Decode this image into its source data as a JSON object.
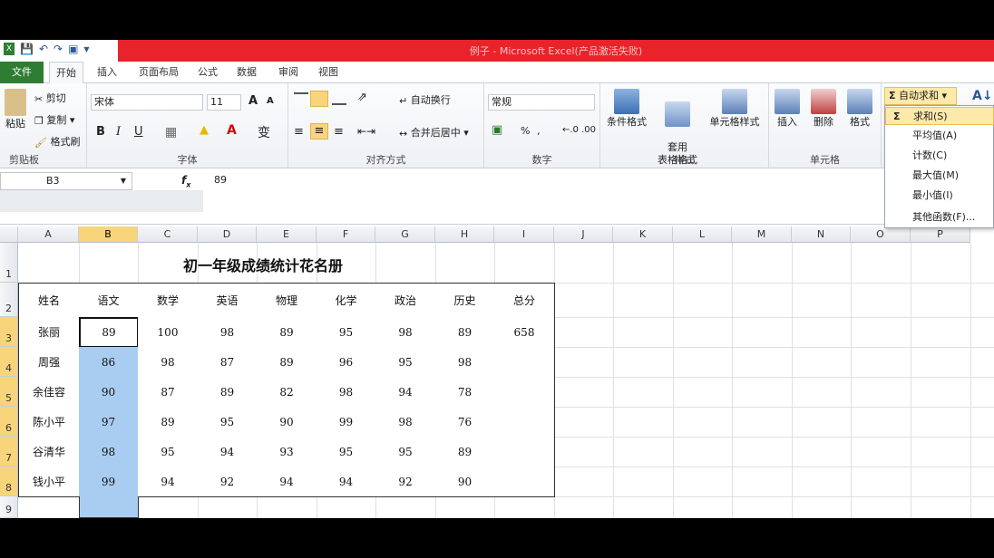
{
  "window": {
    "title": "例子 - Microsoft Excel(产品激活失败)"
  },
  "quick_access": {
    "icons": [
      "save-icon",
      "undo-icon",
      "redo-icon",
      "customize-icon"
    ]
  },
  "tabs": [
    "文件",
    "开始",
    "插入",
    "页面布局",
    "公式",
    "数据",
    "审阅",
    "视图"
  ],
  "ribbon": {
    "clipboard": {
      "label": "剪贴板",
      "paste": "粘贴",
      "cut": "剪切",
      "copy": "复制",
      "format_painter": "格式刷"
    },
    "font": {
      "label": "字体",
      "font_name": "宋体",
      "font_size": "11",
      "grow": "A",
      "shrink": "A",
      "bold": "B",
      "italic": "I",
      "underline": "U",
      "font_color_letter": "A",
      "wen": "变"
    },
    "alignment": {
      "label": "对齐方式",
      "wrap": "自动换行",
      "merge": "合并后居中"
    },
    "number": {
      "label": "数字",
      "format": "常规",
      "percent": "%",
      "comma": ","
    },
    "styles": {
      "label": "样式",
      "conditional": "条件格式",
      "table": "套用\n表格格式",
      "cell_styles": "单元格样式"
    },
    "cells": {
      "label": "单元格",
      "insert": "插入",
      "delete": "删除",
      "format": "格式"
    },
    "editing": {
      "autosum": "自动求和"
    }
  },
  "autosum_menu": {
    "items": [
      "求和(S)",
      "平均值(A)",
      "计数(C)",
      "最大值(M)",
      "最小值(I)",
      "其他函数(F)..."
    ]
  },
  "formula_bar": {
    "name_box": "B3",
    "fx": "f",
    "value": "89"
  },
  "columns": [
    "A",
    "B",
    "C",
    "D",
    "E",
    "F",
    "G",
    "H",
    "I",
    "J",
    "K",
    "L",
    "M",
    "N",
    "O",
    "P"
  ],
  "rows": [
    "1",
    "2",
    "3",
    "4",
    "5",
    "6",
    "7",
    "8",
    "9"
  ],
  "sheet": {
    "title": "初一年级成绩统计花名册",
    "headers": [
      "姓名",
      "语文",
      "数学",
      "英语",
      "物理",
      "化学",
      "政治",
      "历史",
      "总分"
    ],
    "data": [
      [
        "张丽",
        "89",
        "100",
        "98",
        "89",
        "95",
        "98",
        "89",
        "658"
      ],
      [
        "周强",
        "86",
        "98",
        "87",
        "89",
        "96",
        "95",
        "98",
        ""
      ],
      [
        "余佳容",
        "90",
        "87",
        "89",
        "82",
        "98",
        "94",
        "78",
        ""
      ],
      [
        "陈小平",
        "97",
        "89",
        "95",
        "90",
        "99",
        "98",
        "76",
        ""
      ],
      [
        "谷清华",
        "98",
        "95",
        "94",
        "93",
        "95",
        "95",
        "89",
        ""
      ],
      [
        "钱小平",
        "99",
        "94",
        "92",
        "94",
        "94",
        "92",
        "90",
        ""
      ]
    ]
  },
  "selection": {
    "column": "B",
    "rows_highlighted": [
      4,
      5,
      6,
      7,
      8
    ]
  }
}
